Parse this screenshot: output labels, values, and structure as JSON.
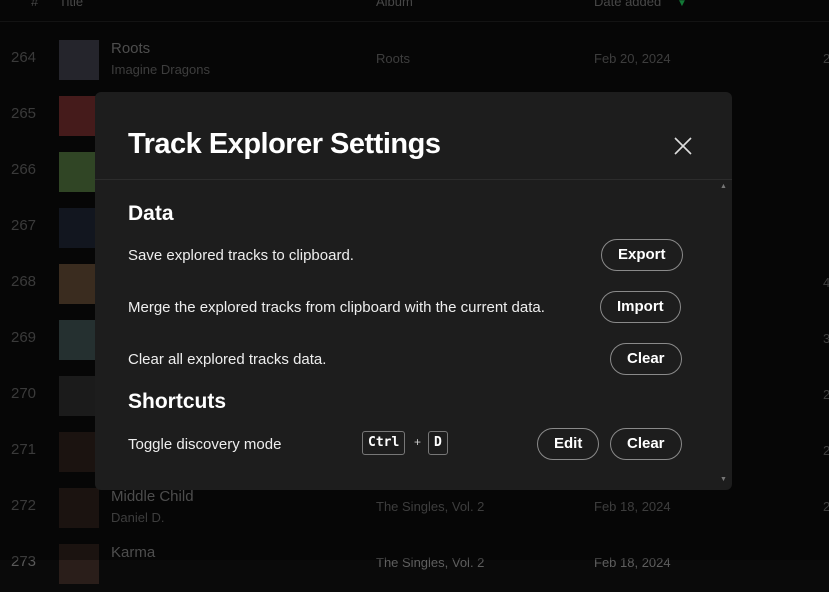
{
  "header": {
    "num": "#",
    "title": "Title",
    "album": "Album",
    "date_added": "Date added"
  },
  "rows": [
    {
      "num": "264",
      "title": "Roots",
      "artist": "Imagine Dragons",
      "album": "Roots",
      "date": "Feb 20, 2024",
      "duration": "2"
    },
    {
      "num": "265"
    },
    {
      "num": "266"
    },
    {
      "num": "267"
    },
    {
      "num": "268",
      "duration": "4"
    },
    {
      "num": "269",
      "duration": "3"
    },
    {
      "num": "270",
      "duration": "2"
    },
    {
      "num": "271",
      "duration": "2"
    },
    {
      "num": "272",
      "title": "Middle Child",
      "artist": "Daniel D.",
      "album": "The Singles, Vol. 2",
      "date": "Feb 18, 2024",
      "duration": "2"
    },
    {
      "num": "273",
      "title": "Karma",
      "album": "The Singles, Vol. 2",
      "date": "Feb 18, 2024"
    }
  ],
  "modal": {
    "title": "Track Explorer Settings",
    "data_heading": "Data",
    "export_label": "Save explored tracks to clipboard.",
    "export_btn": "Export",
    "import_label": "Merge the explored tracks from clipboard with the current data.",
    "import_btn": "Import",
    "clear_label": "Clear all explored tracks data.",
    "clear_btn": "Clear",
    "shortcuts_heading": "Shortcuts",
    "toggle_label": "Toggle discovery mode",
    "key1": "Ctrl",
    "plus": "+",
    "key2": "D",
    "edit_btn": "Edit",
    "shortcut_clear_btn": "Clear"
  },
  "colors": {
    "accent": "#1db954"
  }
}
